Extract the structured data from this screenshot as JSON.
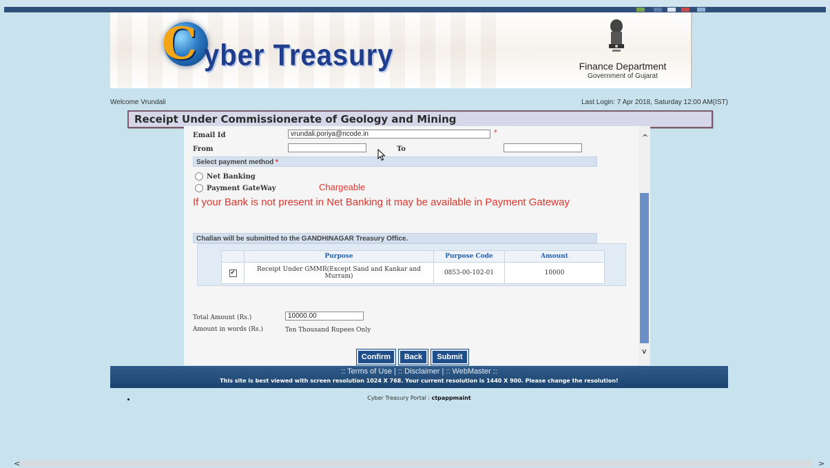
{
  "banner": {
    "brand_initial": "C",
    "brand_rest": "yber Treasury",
    "department": "Finance Department",
    "government": "Government of Gujarat"
  },
  "session": {
    "welcome": "Welcome Vrundali",
    "last_login": "Last Login: 7 Apr 2018, Saturday 12:00 AM(IST)"
  },
  "page": {
    "title": "Receipt Under Commissionerate of Geology and Mining"
  },
  "form": {
    "email_label": "Email Id",
    "email_value": "vrundali.poriya@ncode.in",
    "required_mark": "*",
    "from_label": "From",
    "from_value": "",
    "to_label": "To",
    "to_value": "",
    "payment_section": "Select payment method",
    "options": [
      "Net Banking",
      "Payment GateWay"
    ],
    "chargeable": "Chargeable",
    "bank_message": "If your Bank is not present in Net Banking it may be available in Payment Gateway",
    "challan_note": "Challan will be submitted to the GANDHINAGAR Treasury Office."
  },
  "table": {
    "headers": [
      "Purpose",
      "Purpose Code",
      "Amount"
    ],
    "rows": [
      {
        "checked": true,
        "check_glyph": "✔",
        "purpose": "Receipt Under GMMR(Except Sand and Kankar and Murram)",
        "code": "0853-00-102-01",
        "amount": "10000"
      }
    ]
  },
  "totals": {
    "total_label": "Total Amount (Rs.)",
    "total_value": "10000.00",
    "words_label": "Amount in words (Rs.)",
    "words_value": "Ten Thousand Rupees Only"
  },
  "buttons": {
    "confirm": "Confirm",
    "back": "Back",
    "submit": "Submit"
  },
  "footer": {
    "links": ":: Terms of Use | :: Disclaimer | :: WebMaster ::",
    "resolution_note": "This site is best viewed with screen resolution 1024 X 768. Your current resolution is 1440 X 900. Please change the resolution!"
  },
  "portal": {
    "label": "Cyber Treasury Portal : ",
    "server": "ctpappmaint"
  },
  "icons": {
    "scroll_up": "^",
    "scroll_down": "v",
    "scroll_left": "<",
    "scroll_right": ">"
  },
  "colors": {
    "background": "#c8e2ee",
    "header_blue": "#1f3d8a",
    "button_blue": "#1f4f8a",
    "alert_red": "#e0352b",
    "table_header_blue": "#1f5fb5"
  }
}
